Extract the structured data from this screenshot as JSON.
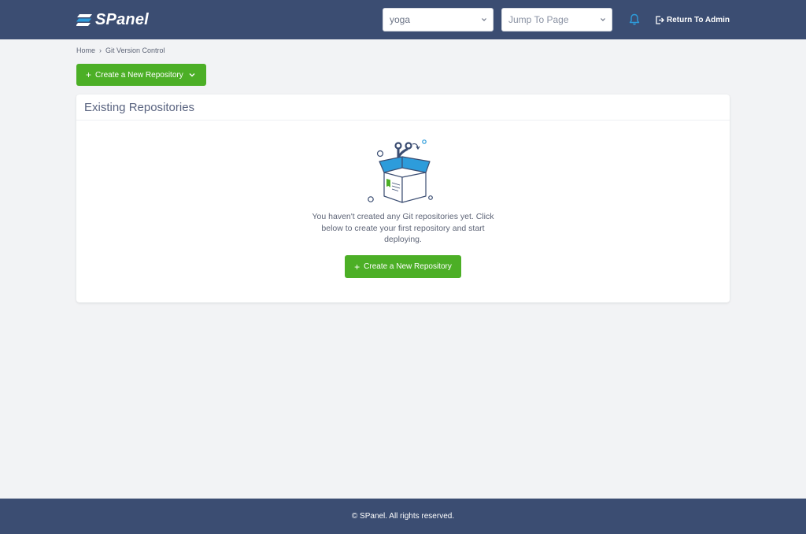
{
  "brand": {
    "name": "SPanel"
  },
  "header": {
    "user_select_value": "yoga",
    "jump_placeholder": "Jump To Page",
    "return_admin_label": "Return To Admin"
  },
  "breadcrumb": {
    "home": "Home",
    "current": "Git Version Control"
  },
  "toolbar": {
    "create_label": "Create a New Repository"
  },
  "card": {
    "title": "Existing Repositories",
    "empty_message": "You haven't created any Git repositories yet. Click below to create your first repository and start deploying.",
    "create_label": "Create a New Repository"
  },
  "footer": {
    "copyright": "© SPanel. All rights reserved."
  },
  "icons": {
    "logo": "spanel-logo-icon",
    "bell": "bell-icon",
    "logout": "logout-icon",
    "chevron": "chevron-down-icon",
    "plus": "plus-icon",
    "empty_box": "git-box-illustration"
  },
  "colors": {
    "header_bg": "#3b4d72",
    "page_bg": "#f2f3f5",
    "accent_green": "#4caf26",
    "bell_blue": "#2d9cdb"
  }
}
